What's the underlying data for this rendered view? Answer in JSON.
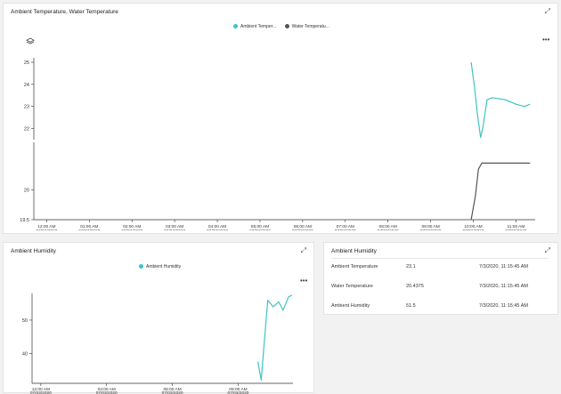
{
  "top_tile": {
    "title": "Ambient Temperature, Water Temperature",
    "legend": [
      {
        "label": "Ambient Temper...",
        "color": "#3ec3c3"
      },
      {
        "label": "Water Temperatu...",
        "color": "#555555"
      }
    ]
  },
  "humidity_tile": {
    "title": "Ambient Humidity",
    "legend": [
      {
        "label": "Ambient Humidity",
        "color": "#3ec3c3"
      }
    ]
  },
  "table_tile": {
    "title": "Ambient Humidity",
    "rows": [
      {
        "name": "Ambient Temperature",
        "value": "23.1",
        "time": "7/3/2020, 11:15:45 AM"
      },
      {
        "name": "Water Temperature",
        "value": "20.4375",
        "time": "7/3/2020, 11:15:45 AM"
      },
      {
        "name": "Ambient Humidity",
        "value": "51.5",
        "time": "7/3/2020, 11:15:45 AM"
      }
    ]
  },
  "icons": {
    "expand": "expand-icon",
    "more": "more-icon",
    "layers": "layers-icon"
  },
  "chart_data": [
    {
      "type": "line",
      "panels": [
        {
          "yticks": [
            22,
            23,
            24,
            25
          ],
          "ylim": [
            21.5,
            25.2
          ]
        },
        {
          "yticks": [
            19.5,
            20
          ],
          "ylim": [
            19.5,
            20.8
          ]
        }
      ],
      "x_ticks": [
        {
          "time": "12:00 AM",
          "date": "07/03/2020"
        },
        {
          "time": "01:00 AM",
          "date": "07/03/2020"
        },
        {
          "time": "02:00 AM",
          "date": "07/03/2020"
        },
        {
          "time": "03:00 AM",
          "date": "07/03/2020"
        },
        {
          "time": "04:00 AM",
          "date": "07/03/2020"
        },
        {
          "time": "05:00 AM",
          "date": "07/03/2020"
        },
        {
          "time": "06:00 AM",
          "date": "07/03/2020"
        },
        {
          "time": "07:00 AM",
          "date": "07/03/2020"
        },
        {
          "time": "08:00 AM",
          "date": "07/03/2020"
        },
        {
          "time": "09:00 AM",
          "date": "07/03/2020"
        },
        {
          "time": "10:00 AM",
          "date": "07/03/2020"
        },
        {
          "time": "11:00 AM",
          "date": "07/03/2020"
        }
      ],
      "xlim": [
        -0.3,
        11.45
      ],
      "series": [
        {
          "name": "Ambient Temper...",
          "color": "#3ec3c3",
          "panel": 0,
          "points": [
            [
              9.95,
              25.0
            ],
            [
              10.02,
              24.0
            ],
            [
              10.1,
              22.6
            ],
            [
              10.17,
              21.6
            ],
            [
              10.23,
              22.1
            ],
            [
              10.32,
              23.3
            ],
            [
              10.45,
              23.4
            ],
            [
              10.75,
              23.3
            ],
            [
              11.0,
              23.1
            ],
            [
              11.2,
              23.0
            ],
            [
              11.33,
              23.1
            ]
          ]
        },
        {
          "name": "Water Temperatu...",
          "color": "#555555",
          "panel": 1,
          "points": [
            [
              9.95,
              19.5
            ],
            [
              10.05,
              19.9
            ],
            [
              10.12,
              20.35
            ],
            [
              10.2,
              20.45
            ],
            [
              10.5,
              20.45
            ],
            [
              11.0,
              20.45
            ],
            [
              11.33,
              20.45
            ]
          ]
        }
      ]
    },
    {
      "type": "line",
      "yticks": [
        40,
        50
      ],
      "ylim": [
        31,
        58
      ],
      "x_ticks": [
        {
          "time": "12:00 AM",
          "date": "07/03/2020"
        },
        {
          "time": "03:00 AM",
          "date": "07/03/2020"
        },
        {
          "time": "06:00 AM",
          "date": "07/03/2020"
        },
        {
          "time": "09:00 AM",
          "date": "07/03/2020"
        }
      ],
      "xlim": [
        -0.4,
        11.5
      ],
      "series": [
        {
          "name": "Ambient Humidity",
          "color": "#3ec3c3",
          "points": [
            [
              9.9,
              37.5
            ],
            [
              10.05,
              32
            ],
            [
              10.35,
              56
            ],
            [
              10.6,
              54
            ],
            [
              10.85,
              55.5
            ],
            [
              11.05,
              53
            ],
            [
              11.3,
              57
            ],
            [
              11.45,
              57.5
            ]
          ]
        }
      ]
    }
  ]
}
